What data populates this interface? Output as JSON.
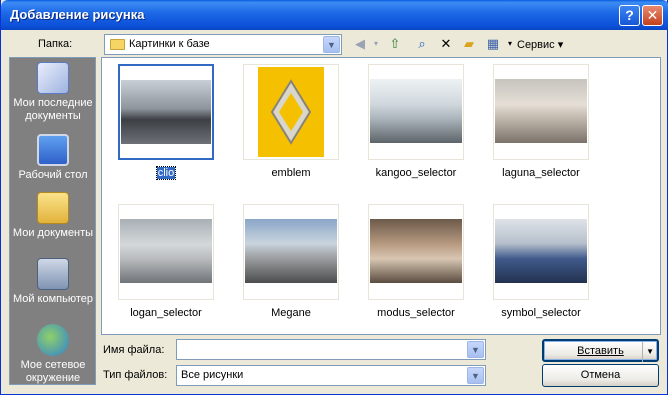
{
  "window": {
    "title": "Добавление рисунка"
  },
  "titlebar": {
    "help": "?",
    "close": "✕"
  },
  "folder": {
    "label": "Папка:",
    "value": "Картинки к базе"
  },
  "toolbar": {
    "service_label": "Сервис"
  },
  "places": [
    {
      "label": "Мои последние документы",
      "icon": "recent-documents-icon"
    },
    {
      "label": "Рабочий стол",
      "icon": "desktop-icon"
    },
    {
      "label": "Мои документы",
      "icon": "my-documents-icon"
    },
    {
      "label": "Мой компьютер",
      "icon": "my-computer-icon"
    },
    {
      "label": "Мое сетевое окружение",
      "icon": "network-places-icon"
    }
  ],
  "files": [
    {
      "name": "clio",
      "selected": true
    },
    {
      "name": "emblem"
    },
    {
      "name": "kangoo_selector"
    },
    {
      "name": "laguna_selector"
    },
    {
      "name": "logan_selector"
    },
    {
      "name": "Megane"
    },
    {
      "name": "modus_selector"
    },
    {
      "name": "symbol_selector"
    }
  ],
  "filename": {
    "label": "Имя файла:",
    "value": ""
  },
  "filetype": {
    "label": "Тип файлов:",
    "value": "Все рисунки"
  },
  "buttons": {
    "insert": "Вставить",
    "cancel": "Отмена"
  },
  "colors": {
    "title_bar": "#0b4fd8",
    "selection": "#316ac5",
    "places_bg": "#808080"
  }
}
